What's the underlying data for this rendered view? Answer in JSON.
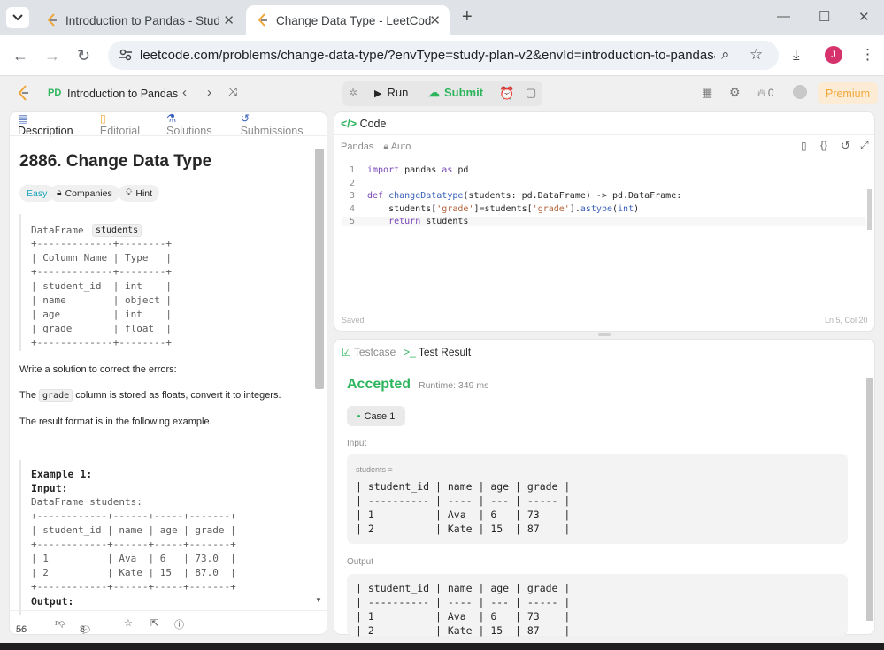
{
  "browser": {
    "tab1_title": "Introduction to Pandas - Study",
    "tab2_title": "Change Data Type - LeetCode",
    "url": "leetcode.com/problems/change-data-type/?envType=study-plan-v2&envId=introduction-to-pandas&l...",
    "avatar_letter": "J"
  },
  "lc": {
    "badge": "PD",
    "study_title": "Introduction to Pandas",
    "run": "Run",
    "submit": "Submit",
    "fire_count": "0",
    "premium": "Premium"
  },
  "left": {
    "tabs": [
      "Description",
      "Editorial",
      "Solutions",
      "Submissions"
    ],
    "title": "2886. Change Data Type",
    "difficulty": "Easy",
    "companies": "Companies",
    "hint": "Hint",
    "df_label": "DataFrame",
    "df_name": "students",
    "schema": "+-------------+--------+\n| Column Name | Type   |\n+-------------+--------+\n| student_id  | int    |\n| name        | object |\n| age         | int    |\n| grade       | float  |\n+-------------+--------+",
    "p1": "Write a solution to correct the errors:",
    "p2_pre": "The",
    "p2_code": "grade",
    "p2_post": "column is stored as floats, convert it to integers.",
    "p3": "The result format is in the following example.",
    "example": "Example 1:\nInput:",
    "example_df": "DataFrame students:",
    "example_tbl": "+------------+------+-----+-------+\n| student_id | name | age | grade |\n+------------+------+-----+-------+\n| 1          | Ava  | 6   | 73.0  |\n| 2          | Kate | 15  | 87.0  |\n+------------+------+-----+-------+",
    "output_label": "Output:",
    "likes": "56",
    "comments": "8"
  },
  "code": {
    "header": "Code",
    "lang": "Pandas",
    "mode": "Auto",
    "lines": [
      {
        "n": "1",
        "t": "import pandas as pd"
      },
      {
        "n": "2",
        "t": ""
      },
      {
        "n": "3",
        "t": "def changeDatatype(students: pd.DataFrame) -> pd.DataFrame:"
      },
      {
        "n": "4",
        "t": "    students['grade']=students['grade'].astype(int)"
      },
      {
        "n": "5",
        "t": "    return students"
      }
    ],
    "saved": "Saved",
    "cursor": "Ln 5, Col 20"
  },
  "result": {
    "tab_testcase": "Testcase",
    "tab_result": "Test Result",
    "status": "Accepted",
    "runtime": "Runtime: 349 ms",
    "case": "Case 1",
    "input_label": "Input",
    "input_var": "students =",
    "input_tbl": "| student_id | name | age | grade |\n| ---------- | ---- | --- | ----- |\n| 1          | Ava  | 6   | 73    |\n| 2          | Kate | 15  | 87    |",
    "output_label": "Output",
    "output_tbl": "| student_id | name | age | grade |\n| ---------- | ---- | --- | ----- |\n| 1          | Ava  | 6   | 73    |\n| 2          | Kate | 15  | 87    |"
  },
  "colors": {
    "accent_green": "#2db55d",
    "premium": "#f0a73a",
    "avatar": "#d6336c"
  }
}
